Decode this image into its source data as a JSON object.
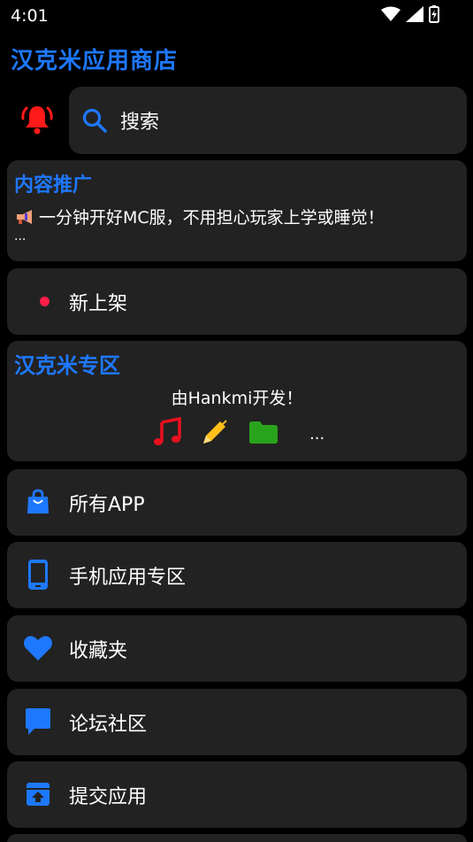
{
  "status": {
    "time": "4:01"
  },
  "app": {
    "title": "汉克米应用商店"
  },
  "search": {
    "label": "搜索"
  },
  "promo": {
    "title": "内容推广",
    "text": "一分钟开好MC服，不用担心玩家上学或睡觉！",
    "more": "..."
  },
  "new_shelf": {
    "label": "新上架"
  },
  "zone": {
    "title": "汉克米专区",
    "subtitle": "由Hankmi开发！",
    "more": "...",
    "icons": [
      "music-note-icon",
      "pencil-icon",
      "folder-icon"
    ]
  },
  "menu": [
    {
      "label": "所有APP",
      "icon": "shopping-bag-icon"
    },
    {
      "label": "手机应用专区",
      "icon": "phone-icon"
    },
    {
      "label": "收藏夹",
      "icon": "heart-icon"
    },
    {
      "label": "论坛社区",
      "icon": "chat-icon"
    },
    {
      "label": "提交应用",
      "icon": "upload-box-icon"
    }
  ],
  "colors": {
    "accent": "#1e78ff",
    "card": "#222222",
    "bell": "#ff1a1a",
    "dot": "#ff1e46",
    "music": "#e8101e",
    "pencil": "#ffbf1a",
    "folder": "#29a31c"
  }
}
